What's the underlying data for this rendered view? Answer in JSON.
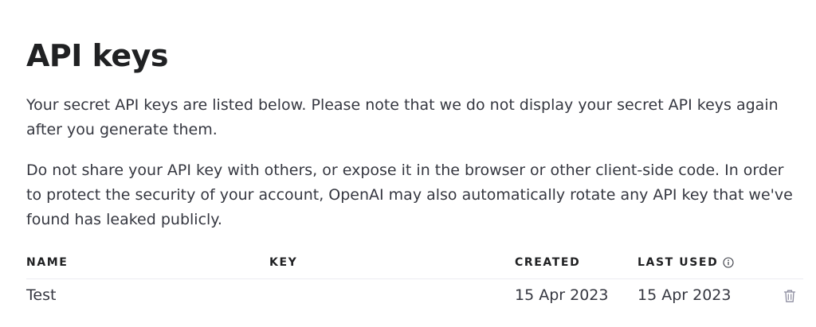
{
  "page": {
    "title": "API keys",
    "paragraph_1": "Your secret API keys are listed below. Please note that we do not display your secret API keys again after you generate them.",
    "paragraph_2": "Do not share your API key with others, or expose it in the browser or other client-side code. In order to protect the security of your account, OpenAI may also automatically rotate any API key that we've found has leaked publicly."
  },
  "table": {
    "headers": {
      "name": "NAME",
      "key": "KEY",
      "created": "CREATED",
      "last_used": "LAST USED"
    },
    "rows": [
      {
        "name": "Test",
        "key": "",
        "created": "15 Apr 2023",
        "last_used": "15 Apr 2023"
      }
    ]
  },
  "icons": {
    "last_used_info": "info-icon",
    "row_delete": "trash-icon"
  },
  "colors": {
    "text_primary": "#202123",
    "text_secondary": "#353740",
    "divider": "#ececf1",
    "icon_muted": "#8e8ea0"
  }
}
